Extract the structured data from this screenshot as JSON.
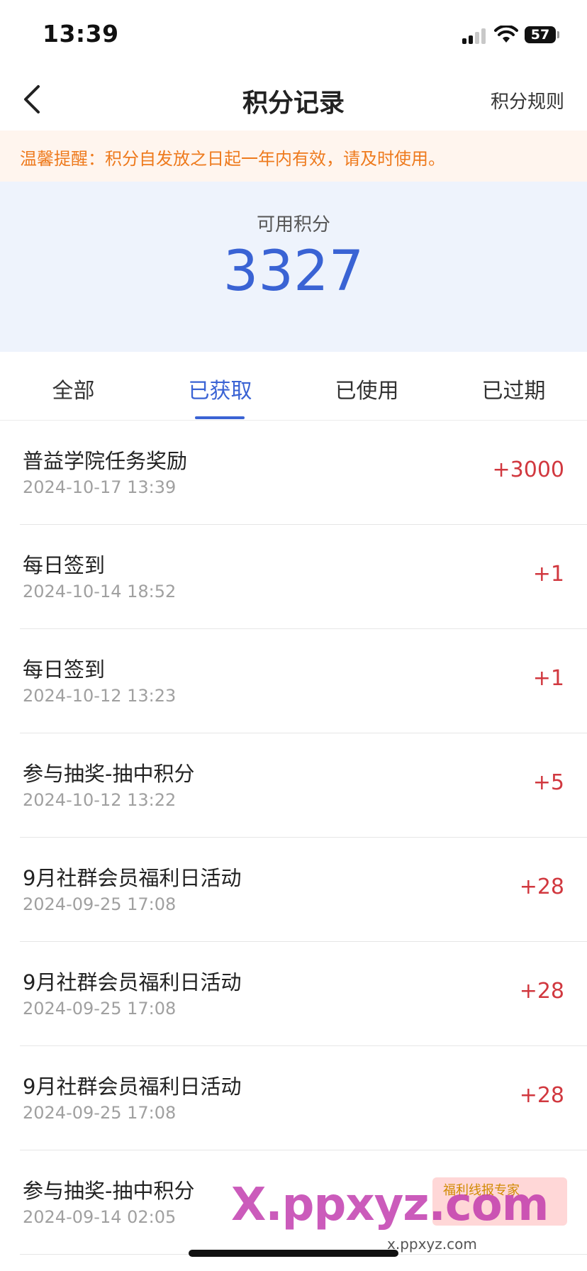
{
  "status_bar": {
    "time": "13:39",
    "battery": "57"
  },
  "nav": {
    "title": "积分记录",
    "rules_link": "积分规则"
  },
  "notice": {
    "text": "温馨提醒：积分自发放之日起一年内有效，请及时使用。"
  },
  "points": {
    "label": "可用积分",
    "value": "3327"
  },
  "tabs": [
    {
      "label": "全部"
    },
    {
      "label": "已获取"
    },
    {
      "label": "已使用"
    },
    {
      "label": "已过期"
    }
  ],
  "active_tab": "已获取",
  "records": [
    {
      "title": "普益学院任务奖励",
      "date": "2024-10-17 13:39",
      "points": "+3000"
    },
    {
      "title": "每日签到",
      "date": "2024-10-14 18:52",
      "points": "+1"
    },
    {
      "title": "每日签到",
      "date": "2024-10-12 13:23",
      "points": "+1"
    },
    {
      "title": "参与抽奖-抽中积分",
      "date": "2024-10-12 13:22",
      "points": "+5"
    },
    {
      "title": "9月社群会员福利日活动",
      "date": "2024-09-25 17:08",
      "points": "+28"
    },
    {
      "title": "9月社群会员福利日活动",
      "date": "2024-09-25 17:08",
      "points": "+28"
    },
    {
      "title": "9月社群会员福利日活动",
      "date": "2024-09-25 17:08",
      "points": "+28"
    },
    {
      "title": "参与抽奖-抽中积分",
      "date": "2024-09-14 02:05",
      "points": ""
    }
  ],
  "watermark": {
    "main": "X.ppxyz.com",
    "small": "x.ppxyz.com",
    "badge": "福利线报专家"
  },
  "colors": {
    "accent": "#3a63d4",
    "points_positive": "#d1383f",
    "notice_text": "#ee7a1d"
  }
}
